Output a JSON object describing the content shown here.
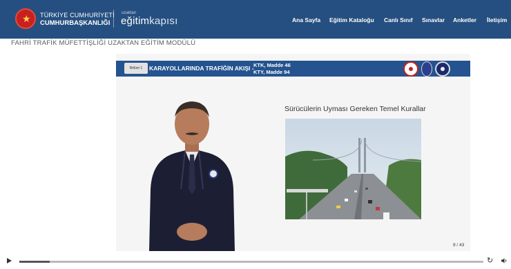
{
  "header": {
    "brand_line1": "TÜRKİYE CUMHURİYETİ",
    "brand_line2": "CUMHURBAŞKANLIĞI",
    "logo_small": "uzaktan",
    "logo_main_bold": "eğitim",
    "logo_main_thin": "kapısı",
    "nav": [
      {
        "label": "Ana Sayfa"
      },
      {
        "label": "Eğitim Kataloğu"
      },
      {
        "label": "Canlı Sınıf"
      },
      {
        "label": "Sınavlar"
      },
      {
        "label": "Anketler"
      },
      {
        "label": "İletişim"
      }
    ]
  },
  "course": {
    "title": "FAHRİ TRAFİK MÜFETTİŞLİĞİ UZAKTAN EĞİTİM MODÜLÜ"
  },
  "slide": {
    "section_label": "Bölüm 1",
    "chapter_title": "KARAYOLLARINDA TRAFİĞİN AKIŞI -",
    "ref_line1": "KTK, Madde 46",
    "ref_line2": "KTY, Madde 94",
    "heading": "Sürücülerin Uyması Gereken Temel Kurallar",
    "page": "9 / 43"
  },
  "player": {
    "progress_fraction": 0.065
  },
  "icons": {
    "play": "play-icon",
    "replay": "replay-icon",
    "volume": "volume-icon"
  },
  "colors": {
    "header_bg": "#254f80",
    "slide_bar": "#24538f",
    "emblem": "#c8201f"
  }
}
